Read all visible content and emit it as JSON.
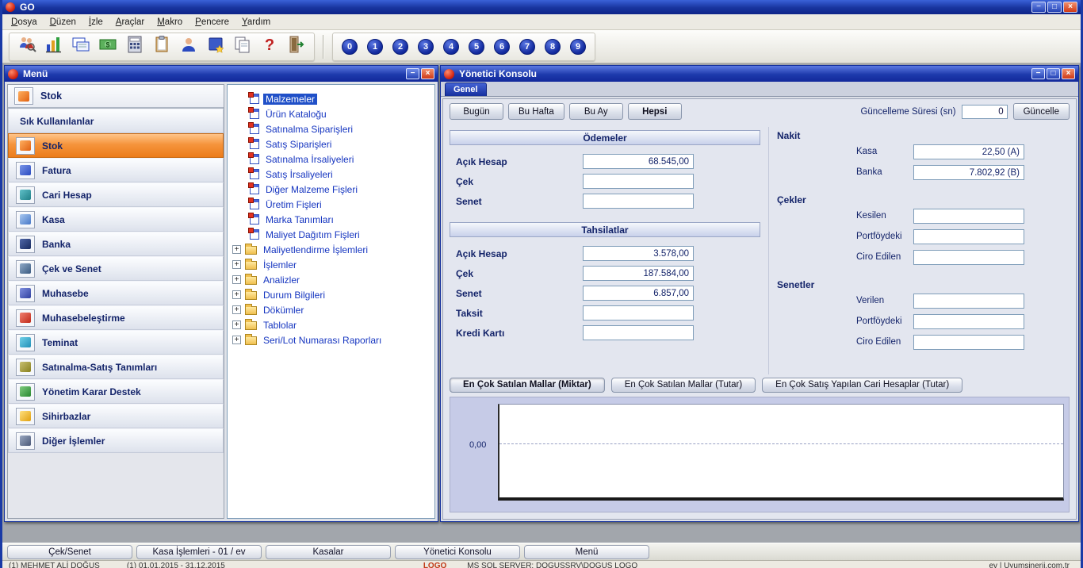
{
  "window": {
    "title": "GO"
  },
  "menubar": {
    "items": [
      "Dosya",
      "Düzen",
      "İzle",
      "Araçlar",
      "Makro",
      "Pencere",
      "Yardım"
    ]
  },
  "toolbar": {
    "numbers": [
      "0",
      "1",
      "2",
      "3",
      "4",
      "5",
      "6",
      "7",
      "8",
      "9"
    ]
  },
  "menu_window": {
    "title": "Menü",
    "header": {
      "label": "Stok"
    },
    "sidebar": [
      {
        "label": "Sık Kullanılanlar"
      },
      {
        "label": "Stok",
        "active": true
      },
      {
        "label": "Fatura"
      },
      {
        "label": "Cari Hesap"
      },
      {
        "label": "Kasa"
      },
      {
        "label": "Banka"
      },
      {
        "label": "Çek ve Senet"
      },
      {
        "label": "Muhasebe"
      },
      {
        "label": "Muhasebeleştirme"
      },
      {
        "label": "Teminat"
      },
      {
        "label": "Satınalma-Satış Tanımları"
      },
      {
        "label": "Yönetim Karar Destek"
      },
      {
        "label": "Sihirbazlar"
      },
      {
        "label": "Diğer İşlemler"
      }
    ],
    "tree": [
      {
        "label": "Malzemeler",
        "selected": true
      },
      {
        "label": "Ürün Kataloğu"
      },
      {
        "label": "Satınalma Siparişleri"
      },
      {
        "label": "Satış Siparişleri"
      },
      {
        "label": "Satınalma İrsaliyeleri"
      },
      {
        "label": "Satış İrsaliyeleri"
      },
      {
        "label": "Diğer Malzeme Fişleri"
      },
      {
        "label": "Üretim Fişleri"
      },
      {
        "label": "Marka Tanımları"
      },
      {
        "label": "Maliyet Dağıtım Fişleri"
      },
      {
        "label": "Maliyetlendirme İşlemleri",
        "folder": true
      },
      {
        "label": "İşlemler",
        "folder": true
      },
      {
        "label": "Analizler",
        "folder": true
      },
      {
        "label": "Durum Bilgileri",
        "folder": true
      },
      {
        "label": "Dökümler",
        "folder": true
      },
      {
        "label": "Tablolar",
        "folder": true
      },
      {
        "label": "Seri/Lot Numarası Raporları",
        "folder": true
      }
    ]
  },
  "console": {
    "title": "Yönetici Konsolu",
    "tab": "Genel",
    "filters": [
      "Bugün",
      "Bu Hafta",
      "Bu Ay",
      "Hepsi"
    ],
    "refresh": {
      "label": "Güncelleme Süresi (sn)",
      "value": "0",
      "button": "Güncelle"
    },
    "payments": {
      "title": "Ödemeler",
      "rows": [
        {
          "label": "Açık Hesap",
          "value": "68.545,00"
        },
        {
          "label": "Çek",
          "value": ""
        },
        {
          "label": "Senet",
          "value": ""
        }
      ]
    },
    "collections": {
      "title": "Tahsilatlar",
      "rows": [
        {
          "label": "Açık Hesap",
          "value": "3.578,00"
        },
        {
          "label": "Çek",
          "value": "187.584,00"
        },
        {
          "label": "Senet",
          "value": "6.857,00"
        },
        {
          "label": "Taksit",
          "value": ""
        },
        {
          "label": "Kredi Kartı",
          "value": ""
        }
      ]
    },
    "groups": [
      {
        "title": "Nakit",
        "rows": [
          {
            "label": "Kasa",
            "value": "22,50 (A)"
          },
          {
            "label": "Banka",
            "value": "7.802,92 (B)"
          }
        ]
      },
      {
        "title": "Çekler",
        "rows": [
          {
            "label": "Kesilen",
            "value": ""
          },
          {
            "label": "Portföydeki",
            "value": ""
          },
          {
            "label": "Ciro Edilen",
            "value": ""
          }
        ]
      },
      {
        "title": "Senetler",
        "rows": [
          {
            "label": "Verilen",
            "value": ""
          },
          {
            "label": "Portföydeki",
            "value": ""
          },
          {
            "label": "Ciro Edilen",
            "value": ""
          }
        ]
      }
    ],
    "chart_tabs": [
      "En Çok Satılan Mallar (Miktar)",
      "En Çok Satılan Mallar (Tutar)",
      "En Çok Satış Yapılan Cari Hesaplar (Tutar)"
    ],
    "chart": {
      "y_tick": "0,00"
    }
  },
  "chart_data": {
    "type": "bar",
    "title": "En Çok Satılan Mallar (Miktar)",
    "categories": [],
    "values": [],
    "y_ticks": [
      "0,00"
    ]
  },
  "taskbar": {
    "buttons": [
      "Çek/Senet",
      "Kasa İşlemleri - 01 / ev",
      "Kasalar",
      "Yönetici Konsolu",
      "Menü"
    ]
  },
  "statusbar": {
    "user": "(1) MEHMET ALİ DOĞUŞ",
    "period": "(1) 01.01.2015 - 31.12.2015",
    "brand": "LOGO",
    "server": "MS SQL SERVER: DOGUSSRV\\DOGUS LOGO",
    "site": "ev | Uyumsinerji.com.tr"
  }
}
